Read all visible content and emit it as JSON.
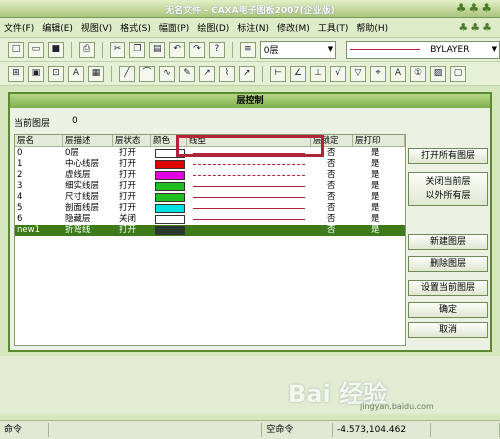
{
  "title": "无名文件 - CAXA电子图板2007(企业版)",
  "menu": [
    "文件(F)",
    "编辑(E)",
    "视图(V)",
    "格式(S)",
    "幅面(P)",
    "绘图(D)",
    "标注(N)",
    "修改(M)",
    "工具(T)",
    "帮助(H)"
  ],
  "toolbar": {
    "layer_combo": "0层",
    "linetype_combo": "BYLAYER"
  },
  "dialog": {
    "title": "层控制",
    "current_layer_label": "当前图层",
    "current_layer_value": "0",
    "columns": [
      "层名",
      "层描述",
      "层状态",
      "颜色",
      "线型",
      "层锁定",
      "层打印"
    ],
    "rows": [
      {
        "name": "0",
        "desc": "0层",
        "state": "打开",
        "color": "#ffffff",
        "line": "solid",
        "linecolor": "#b0243a",
        "lock": "否",
        "print": "是"
      },
      {
        "name": "1",
        "desc": "中心线层",
        "state": "打开",
        "color": "#e00000",
        "line": "dashdot",
        "linecolor": "#b0243a",
        "lock": "否",
        "print": "是"
      },
      {
        "name": "2",
        "desc": "虚线层",
        "state": "打开",
        "color": "#e000e0",
        "line": "dashed",
        "linecolor": "#b0243a",
        "lock": "否",
        "print": "是"
      },
      {
        "name": "3",
        "desc": "细实线层",
        "state": "打开",
        "color": "#20c020",
        "line": "solid",
        "linecolor": "#b0243a",
        "lock": "否",
        "print": "是"
      },
      {
        "name": "4",
        "desc": "尺寸线层",
        "state": "打开",
        "color": "#20c020",
        "line": "solid",
        "linecolor": "#b0243a",
        "lock": "否",
        "print": "是"
      },
      {
        "name": "5",
        "desc": "剖面线层",
        "state": "打开",
        "color": "#00e0e0",
        "line": "solid",
        "linecolor": "#b0243a",
        "lock": "否",
        "print": "是"
      },
      {
        "name": "6",
        "desc": "隐藏层",
        "state": "关闭",
        "color": "#ffffff",
        "line": "solid",
        "linecolor": "#b0243a",
        "lock": "否",
        "print": "是"
      },
      {
        "name": "new1",
        "desc": "折弯线",
        "state": "打开",
        "color": "#2a3a2a",
        "line": "none",
        "linecolor": "#ffffff",
        "lock": "否",
        "print": "是"
      }
    ],
    "selected_row": 7,
    "buttons": {
      "open_all": "打开所有图层",
      "close_except_line1": "关闭当前层",
      "close_except_line2": "以外所有层",
      "new_layer": "新建图层",
      "delete_layer": "删除图层",
      "set_current": "设置当前图层",
      "ok": "确定",
      "cancel": "取消"
    }
  },
  "statusbar": {
    "cmd": "命令",
    "empty_cmd": "空命令",
    "coords": "-4.573,104.462"
  },
  "watermark": {
    "brand": "Bai 经验",
    "url": "jingyan.baidu.com"
  }
}
